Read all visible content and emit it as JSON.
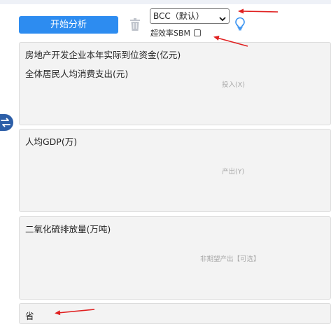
{
  "toolbar": {
    "run_label": "开始分析",
    "model_selected": "BCC（默认）",
    "sbm_label": "超效率SBM",
    "sbm_checked": false
  },
  "icons": {
    "trash": "trash-icon",
    "bulb": "lightbulb-icon",
    "swap": "swap-icon",
    "chevron": "chevron-down-icon"
  },
  "panels": {
    "inputs": {
      "items": [
        "房地产开发企业本年实际到位资金(亿元)",
        "全体居民人均消费支出(元)"
      ],
      "hint": "投入(X)"
    },
    "outputs": {
      "items": [
        "人均GDP(万)"
      ],
      "hint": "产出(Y)"
    },
    "undesirable": {
      "items": [
        "二氧化硫排放量(万吨)"
      ],
      "hint": "非期望产出【可选】"
    },
    "id": {
      "items": [
        "省"
      ]
    }
  },
  "colors": {
    "accent": "#2d8cf0",
    "annotation": "#e02020",
    "panel_bg": "#f3f3f3"
  }
}
